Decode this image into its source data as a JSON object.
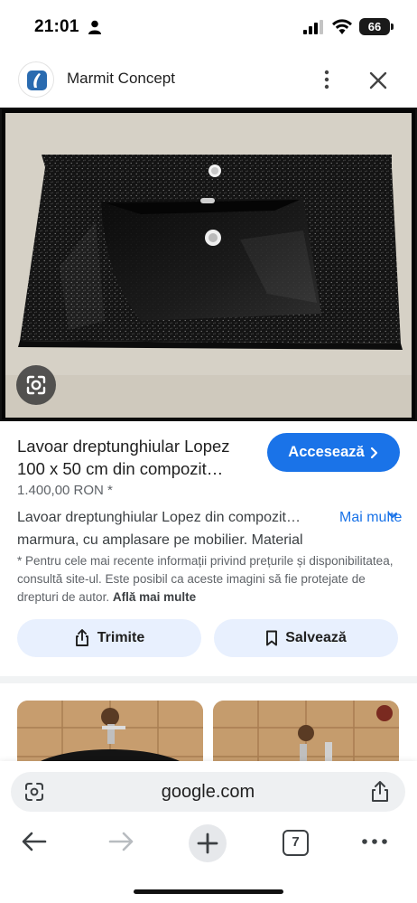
{
  "status_bar": {
    "time": "21:01",
    "battery": "66"
  },
  "header": {
    "site_name": "Marmit Concept"
  },
  "product": {
    "title": "Lavoar dreptunghiular Lopez 100 x 50 cm din compozit…",
    "price": "1.400,00 RON *",
    "visit_label": "Accesează",
    "description": "Lavoar dreptunghiular Lopez din compozit… marmura, cu amplasare pe mobilier. Material",
    "more_label": "Mai multe",
    "disclaimer": "* Pentru cele mai recente informații privind prețurile și disponibilitatea, consultă site-ul. Este posibil ca aceste imagini să fie protejate de drepturi de autor.",
    "learn_more": "Află mai multe"
  },
  "actions": {
    "share_label": "Trimite",
    "save_label": "Salvează"
  },
  "browser": {
    "url": "google.com",
    "tab_count": "7"
  },
  "colors": {
    "accent": "#1a73e8",
    "action_bg": "#e8f0fe",
    "sink": "#111111"
  },
  "icons": {
    "more": "more-vert-icon",
    "close": "close-icon",
    "lens": "google-lens-icon",
    "share": "share-icon",
    "bookmark": "bookmark-icon",
    "back": "arrow-back-icon",
    "forward": "arrow-forward-icon",
    "new_tab": "plus-icon",
    "menu": "more-horiz-icon"
  }
}
